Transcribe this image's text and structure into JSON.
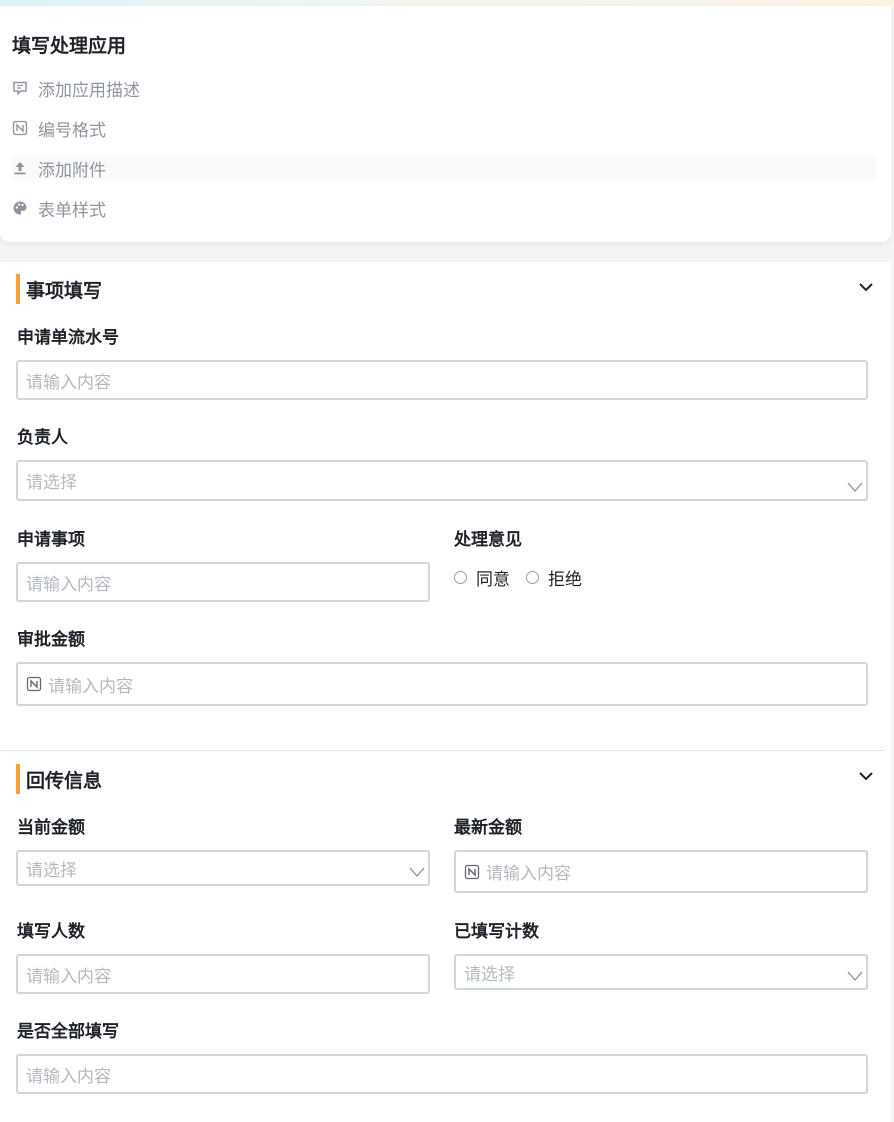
{
  "app": {
    "title": "填写处理应用",
    "actions": [
      {
        "label": "添加应用描述",
        "icon": "comment-icon"
      },
      {
        "label": "编号格式",
        "icon": "number-format-icon"
      },
      {
        "label": "添加附件",
        "icon": "upload-icon"
      },
      {
        "label": "表单样式",
        "icon": "palette-icon"
      }
    ]
  },
  "sections": [
    {
      "title": "事项填写",
      "fields": {
        "serial_no": {
          "label": "申请单流水号",
          "placeholder": "请输入内容"
        },
        "owner": {
          "label": "负责人",
          "placeholder": "请选择"
        },
        "matter": {
          "label": "申请事项",
          "placeholder": "请输入内容"
        },
        "opinion": {
          "label": "处理意见",
          "options": [
            "同意",
            "拒绝"
          ]
        },
        "amount": {
          "label": "审批金额",
          "placeholder": "请输入内容"
        }
      }
    },
    {
      "title": "回传信息",
      "fields": {
        "current_amount": {
          "label": "当前金额",
          "placeholder": "请选择"
        },
        "latest_amount": {
          "label": "最新金额",
          "placeholder": "请输入内容"
        },
        "fill_count": {
          "label": "填写人数",
          "placeholder": "请输入内容"
        },
        "filled_count": {
          "label": "已填写计数",
          "placeholder": "请选择"
        },
        "all_filled": {
          "label": "是否全部填写",
          "placeholder": "请输入内容"
        }
      }
    }
  ],
  "colors": {
    "accent": "#f7a033",
    "border": "#d1d6dd",
    "placeholder": "#b5b9c0"
  }
}
